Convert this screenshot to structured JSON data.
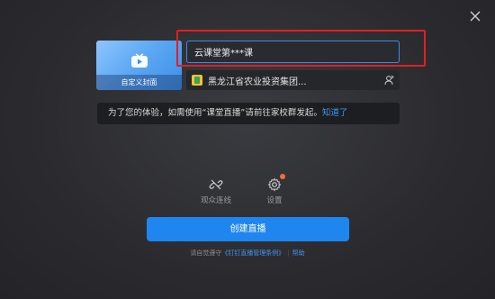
{
  "cover": {
    "label": "自定义封面",
    "icon": "tv-play-icon"
  },
  "title_input": {
    "value": "云课堂第***课"
  },
  "org": {
    "name": "黑龙江省农业投资集团...",
    "switch_icon": "user-switch-icon"
  },
  "notice": {
    "text": "为了您的体验，如需使用“课堂直播”请前往家校群发起。",
    "link": "知道了"
  },
  "tools": [
    {
      "label": "观众连线",
      "icon": "link-off-icon"
    },
    {
      "label": "设置",
      "icon": "gear-icon"
    }
  ],
  "create_button": "创建直播",
  "footer": {
    "prefix": "请自觉遵守",
    "link": "《钉钉直播管理条例》",
    "help": "帮助"
  },
  "colors": {
    "accent": "#1f86f0",
    "highlight": "#e02020",
    "badge": "#ff6a3d"
  }
}
